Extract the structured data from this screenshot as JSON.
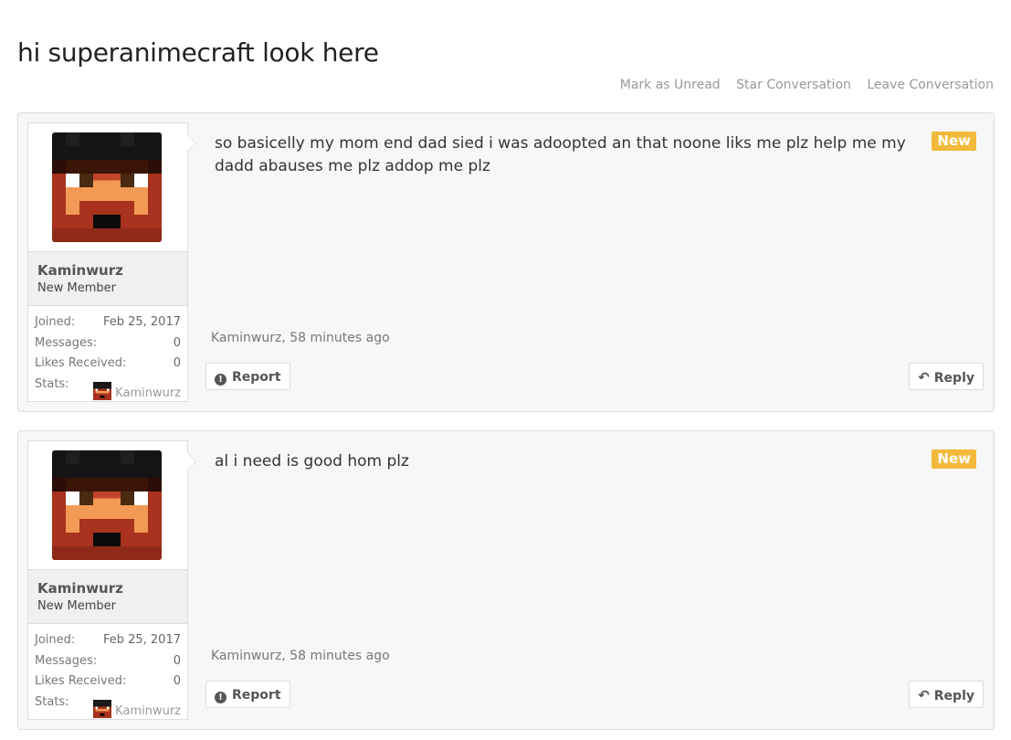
{
  "page": {
    "title": "hi superanimecraft look here",
    "actions": [
      "Mark as Unread",
      "Star Conversation",
      "Leave Conversation"
    ]
  },
  "posts": [
    {
      "username": "Kaminwurz",
      "user_title": "New Member",
      "stats": {
        "joined_label": "Joined:",
        "joined": "Feb 25, 2017",
        "messages_label": "Messages:",
        "messages": "0",
        "likes_label": "Likes Received:",
        "likes": "0",
        "stats_label": "Stats:",
        "stats_user": "Kaminwurz"
      },
      "message": "so basicelly my mom end dad sied i was adoopted an that noone liks me plz help me my dadd abauses me plz addop me plz",
      "new_tag": "New",
      "meta": "Kaminwurz, 58 minutes ago",
      "report_label": "Report",
      "reply_label": "Reply"
    },
    {
      "username": "Kaminwurz",
      "user_title": "New Member",
      "stats": {
        "joined_label": "Joined:",
        "joined": "Feb 25, 2017",
        "messages_label": "Messages:",
        "messages": "0",
        "likes_label": "Likes Received:",
        "likes": "0",
        "stats_label": "Stats:",
        "stats_user": "Kaminwurz"
      },
      "message": "al i need is good hom plz",
      "new_tag": "New",
      "meta": "Kaminwurz, 58 minutes ago",
      "report_label": "Report",
      "reply_label": "Reply"
    }
  ],
  "colors": {
    "new_tag": "#f3b93a",
    "link_muted": "#999999",
    "panel": "#f7f7f7"
  },
  "icons": {
    "report": "exclamation-circle-icon",
    "reply": "reply-arrow-icon",
    "avatar": "minecraft-skin-avatar"
  }
}
